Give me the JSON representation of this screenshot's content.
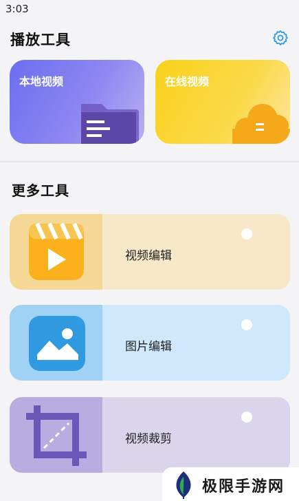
{
  "status_bar": {
    "time": "3:03"
  },
  "play_tools": {
    "title": "播放工具",
    "settings_icon": "gear-icon",
    "cards": [
      {
        "label": "本地视频",
        "icon": "folder-icon",
        "color": "#7b7cf0"
      },
      {
        "label": "在线视频",
        "icon": "cloud-icon",
        "color": "#f9d21a"
      }
    ]
  },
  "more_tools": {
    "title": "更多工具",
    "items": [
      {
        "label": "视频编辑",
        "icon": "clapper-play-icon",
        "color": "#f6e8c9"
      },
      {
        "label": "图片编辑",
        "icon": "image-icon",
        "color": "#cfe8fb"
      },
      {
        "label": "视频裁剪",
        "icon": "crop-icon",
        "color": "#dad5ea"
      }
    ]
  },
  "watermark": {
    "text": "极限手游网"
  }
}
